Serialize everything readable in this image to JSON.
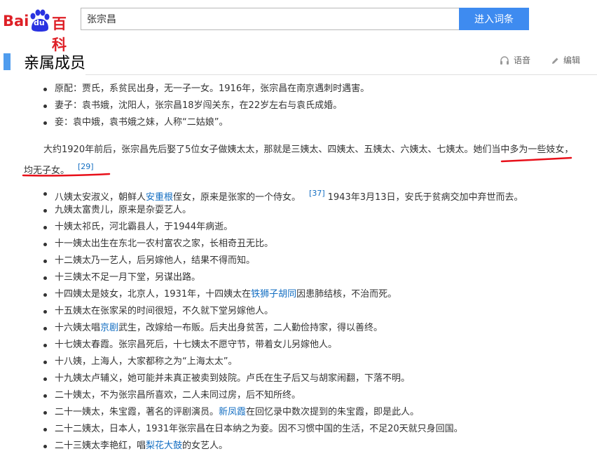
{
  "logo": {
    "bai": "Bai",
    "du": "du",
    "baike": "百科"
  },
  "search": {
    "value": "张宗昌",
    "button": "进入词条"
  },
  "section": {
    "title": "亲属成员",
    "audio": "语音",
    "edit": "编辑"
  },
  "family": [
    "原配：贾氏，系贫民出身，无一子一女。1916年，张宗昌在南京遇刺时遇害。",
    "妻子：袁书娥，沈阳人，张宗昌18岁闯关东，在22岁左右与袁氏成婚。",
    "妾：袁中娥，袁书娥之妹，人称“二姑娘”。"
  ],
  "paragraph": {
    "text": "大约1920年前后，张宗昌先后娶了5位女子做姨太太，那就是三姨太、四姨太、五姨太、六姨太、七姨太。她们当中多为一些妓女，均无子女。",
    "ref": "[29]"
  },
  "concubines": [
    {
      "pre": "八姨太安淑义，朝鲜人",
      "link": "安重根",
      "post": "侄女，原来是张家的一个侍女。",
      "ref": "[37]",
      "tail": "1943年3月13日，安氏于贫病交加中弃世而去。"
    },
    {
      "pre": "九姨太富贵儿，原来是杂耍艺人。"
    },
    {
      "pre": "十姨太祁氏，河北霸县人，于1944年病逝。"
    },
    {
      "pre": "十一姨太出生在东北一农村富农之家，长相奇丑无比。"
    },
    {
      "pre": "十二姨太乃一艺人，后另嫁他人，结果不得而知。"
    },
    {
      "pre": "十三姨太不足一月下堂，另谋出路。"
    },
    {
      "pre": "十四姨太是妓女，北京人，1931年，十四姨太在",
      "link": "铁狮子胡同",
      "post": "因患肺结核，不治而死。"
    },
    {
      "pre": "十五姨太在张家呆的时间很短，不久就下堂另嫁他人。"
    },
    {
      "pre": "十六姨太唱",
      "link": "京剧",
      "post": "武生，改嫁给一布贩。后夫出身贫苦，二人勤俭持家，得以善终。"
    },
    {
      "pre": "十七姨太春霞。张宗昌死后，十七姨太不愿守节，带着女儿另嫁他人。"
    },
    {
      "pre": "十八姨，上海人，大家都称之为“上海太太”。"
    },
    {
      "pre": "十九姨太卢辅义，她可能并未真正被卖到妓院。卢氏在生子后又与胡家闹翻，下落不明。"
    },
    {
      "pre": "二十姨太，不为张宗昌所喜欢，二人未同过房，后不知所终。"
    },
    {
      "pre": "二十一姨太，朱宝霞，著名的评剧演员。",
      "link": "新凤霞",
      "post": "在回忆录中数次提到的朱宝霞，即是此人。"
    },
    {
      "pre": "二十二姨太，日本人，1931年张宗昌在日本纳之为妾。因不习惯中国的生活，不足20天就只身回国。"
    },
    {
      "pre": "二十三姨太李艳红，唱",
      "link": "梨花大鼓",
      "post": "的女艺人。"
    }
  ],
  "colors": {
    "accent": "#4f9cee",
    "button": "#3e8bf0",
    "link": "#136ec2",
    "annotation": "#e8101a",
    "logo": "#de1f26"
  }
}
